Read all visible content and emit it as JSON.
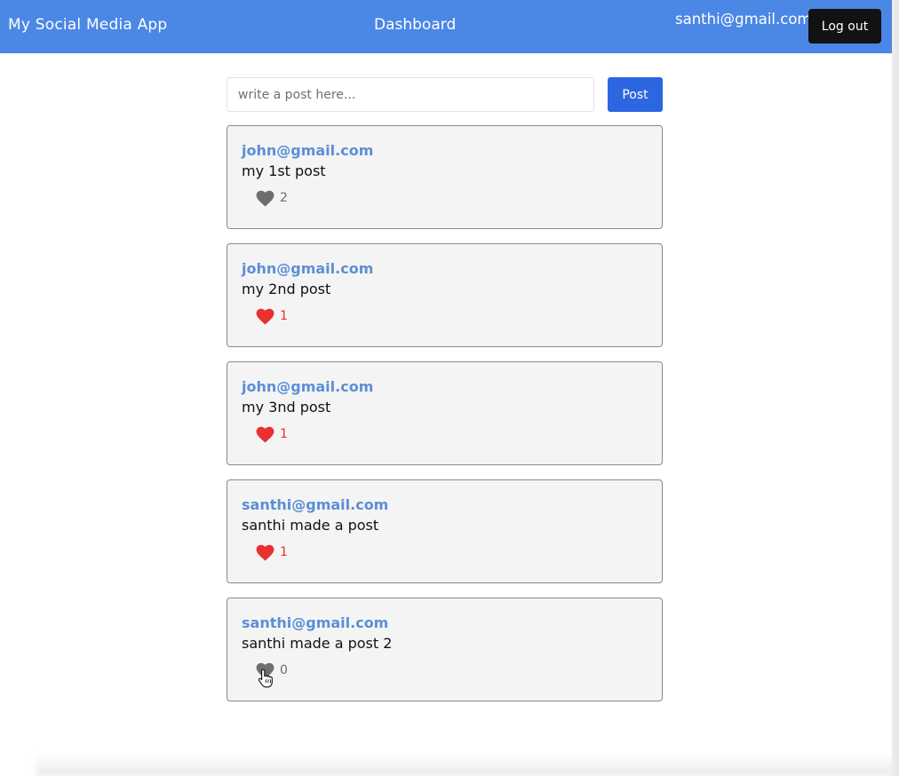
{
  "header": {
    "brand": "My Social Media App",
    "title": "Dashboard",
    "user_email": "santhi@gmail.com",
    "logout_label": "Log out",
    "color": "#4b87e5"
  },
  "composer": {
    "placeholder": "write a post here...",
    "value": "",
    "post_label": "Post",
    "button_color": "#2c66e0"
  },
  "posts": [
    {
      "author": "john@gmail.com",
      "text": "my 1st post",
      "likes": "2",
      "liked": false
    },
    {
      "author": "john@gmail.com",
      "text": "my 2nd post",
      "likes": "1",
      "liked": true
    },
    {
      "author": "john@gmail.com",
      "text": "my 3nd post",
      "likes": "1",
      "liked": true
    },
    {
      "author": "santhi@gmail.com",
      "text": "santhi made a post",
      "likes": "1",
      "liked": true
    },
    {
      "author": "santhi@gmail.com",
      "text": "santhi made a post 2",
      "likes": "0",
      "liked": false
    }
  ],
  "colors": {
    "liked_heart": "#e8302f",
    "unliked_heart": "#6e6e6e",
    "author_link": "#5b8fd6"
  },
  "icons": {
    "like": "heart-icon",
    "cursor": "hand-pointer-icon"
  }
}
